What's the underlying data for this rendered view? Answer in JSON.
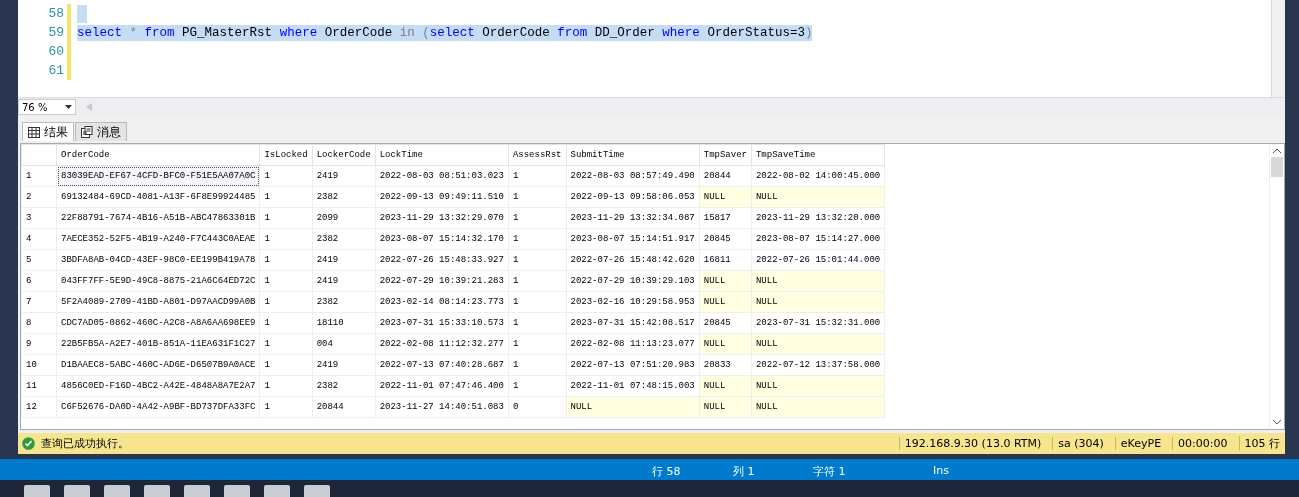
{
  "editor": {
    "lines": [
      {
        "number": "58",
        "selected": true
      },
      {
        "number": "59",
        "selected": true,
        "tokens": [
          {
            "kind": "keyword",
            "text": "select",
            "attached": true
          },
          {
            "kind": "operator",
            "text": "*",
            "attached": false
          },
          {
            "kind": "keyword",
            "text": "from",
            "attached": false
          },
          {
            "kind": "ident",
            "text": "PG_MasterRst",
            "attached": false
          },
          {
            "kind": "keyword",
            "text": "where",
            "attached": false
          },
          {
            "kind": "ident",
            "text": "OrderCode",
            "attached": false
          },
          {
            "kind": "operator",
            "text": "in",
            "attached": false
          },
          {
            "kind": "operator",
            "text": "(",
            "attached": false
          },
          {
            "kind": "keyword",
            "text": "select",
            "attached": true
          },
          {
            "kind": "ident",
            "text": "OrderCode",
            "attached": false
          },
          {
            "kind": "keyword",
            "text": "from",
            "attached": false
          },
          {
            "kind": "ident",
            "text": "DD_Order",
            "attached": false
          },
          {
            "kind": "keyword",
            "text": "where",
            "attached": false
          },
          {
            "kind": "ident",
            "text": "OrderStatus=3",
            "attached": false
          },
          {
            "kind": "operator",
            "text": ")",
            "attached": true
          }
        ]
      },
      {
        "number": "60",
        "selected": false
      },
      {
        "number": "61",
        "selected": false
      }
    ],
    "zoom": "76 %"
  },
  "tabs": [
    {
      "label": "结果",
      "kind": "grid",
      "selected": true
    },
    {
      "label": "消息",
      "kind": "message",
      "selected": false
    }
  ],
  "grid": {
    "columns": [
      "OrderCode",
      "IsLocked",
      "LockerCode",
      "LockTime",
      "AssessRst",
      "SubmitTime",
      "TmpSaver",
      "TmpSaveTime"
    ],
    "rows": [
      {
        "number": "1",
        "focused": true,
        "cells": [
          "83039EAD-EF67-4CFD-BFC0-F51E5AA07A0C",
          "1",
          "2419",
          "2022-08-03 08:51:03.023",
          "1",
          "2022-08-03 08:57:49.490",
          "20844",
          "2022-08-02 14:00:45.000"
        ]
      },
      {
        "number": "2",
        "focused": false,
        "nulls": [
          false,
          false,
          false,
          false,
          false,
          false,
          true,
          true
        ],
        "cells": [
          "69132484-69CD-4081-A13F-6F8E99924485",
          "1",
          "2382",
          "2022-09-13 09:49:11.510",
          "1",
          "2022-09-13 09:58:06.053",
          "NULL",
          "NULL"
        ]
      },
      {
        "number": "3",
        "focused": false,
        "cells": [
          "22F88791-7674-4B16-A51B-ABC47863301B",
          "1",
          "2099",
          "2023-11-29 13:32:29.070",
          "1",
          "2023-11-29 13:32:34.087",
          "15817",
          "2023-11-29 13:32:20.000"
        ]
      },
      {
        "number": "4",
        "focused": false,
        "cells": [
          "7AECE352-52F5-4B19-A240-F7C443C0AEAE",
          "1",
          "2382",
          "2023-08-07 15:14:32.170",
          "1",
          "2023-08-07 15:14:51.917",
          "20845",
          "2023-08-07 15:14:27.000"
        ]
      },
      {
        "number": "5",
        "focused": false,
        "cells": [
          "3BDFA8AB-04CD-43EF-98C0-EE199B419A78",
          "1",
          "2419",
          "2022-07-26 15:48:33.927",
          "1",
          "2022-07-26 15:48:42.620",
          "16811",
          "2022-07-26 15:01:44.000"
        ]
      },
      {
        "number": "6",
        "focused": false,
        "nulls": [
          false,
          false,
          false,
          false,
          false,
          false,
          true,
          true
        ],
        "cells": [
          "043FF7FF-5E9D-49C8-8875-21A6C64ED72C",
          "1",
          "2419",
          "2022-07-29 10:39:21.283",
          "1",
          "2022-07-29 10:39:29.103",
          "NULL",
          "NULL"
        ]
      },
      {
        "number": "7",
        "focused": false,
        "nulls": [
          false,
          false,
          false,
          false,
          false,
          false,
          true,
          true
        ],
        "cells": [
          "5F2A4089-2709-41BD-A801-D97AACD99A0B",
          "1",
          "2382",
          "2023-02-14 08:14:23.773",
          "1",
          "2023-02-16 10:29:58.953",
          "NULL",
          "NULL"
        ]
      },
      {
        "number": "8",
        "focused": false,
        "cells": [
          "CDC7AD05-0862-460C-A2C8-A8A6AA698EE9",
          "1",
          "18110",
          "2023-07-31 15:33:10.573",
          "1",
          "2023-07-31 15:42:08.517",
          "20845",
          "2023-07-31 15:32:31.000"
        ]
      },
      {
        "number": "9",
        "focused": false,
        "nulls": [
          false,
          false,
          false,
          false,
          false,
          false,
          true,
          true
        ],
        "cells": [
          "22B5FB5A-A2E7-401B-851A-11EA631F1C27",
          "1",
          "004",
          "2022-02-08 11:12:32.277",
          "1",
          "2022-02-08 11:13:23.077",
          "NULL",
          "NULL"
        ]
      },
      {
        "number": "10",
        "focused": false,
        "cells": [
          "D1BAAEC8-5ABC-460C-AD6E-D6507B9A0ACE",
          "1",
          "2419",
          "2022-07-13 07:40:28.687",
          "1",
          "2022-07-13 07:51:20.983",
          "20833",
          "2022-07-12 13:37:58.000"
        ]
      },
      {
        "number": "11",
        "focused": false,
        "nulls": [
          false,
          false,
          false,
          false,
          false,
          false,
          true,
          true
        ],
        "cells": [
          "4856C0ED-F16D-4BC2-A42E-4848A8A7E2A7",
          "1",
          "2382",
          "2022-11-01 07:47:46.400",
          "1",
          "2022-11-01 07:48:15.003",
          "NULL",
          "NULL"
        ]
      },
      {
        "number": "12",
        "focused": false,
        "nulls": [
          false,
          false,
          false,
          false,
          false,
          true,
          true,
          true
        ],
        "cells": [
          "C6F52676-DA0D-4A42-A9BF-BD737DFA33FC",
          "1",
          "20844",
          "2023-11-27 14:40:51.083",
          "0",
          "NULL",
          "NULL",
          "NULL"
        ]
      }
    ]
  },
  "status": {
    "message": "查询已成功执行。",
    "server": "192.168.9.30 (13.0 RTM)",
    "user": "sa (304)",
    "database": "eKeyPE",
    "elapsed": "00:00:00",
    "rows": "105 行"
  },
  "ide_status": {
    "line": "行 58",
    "column": "列 1",
    "char": "字符 1",
    "mode": "Ins"
  }
}
